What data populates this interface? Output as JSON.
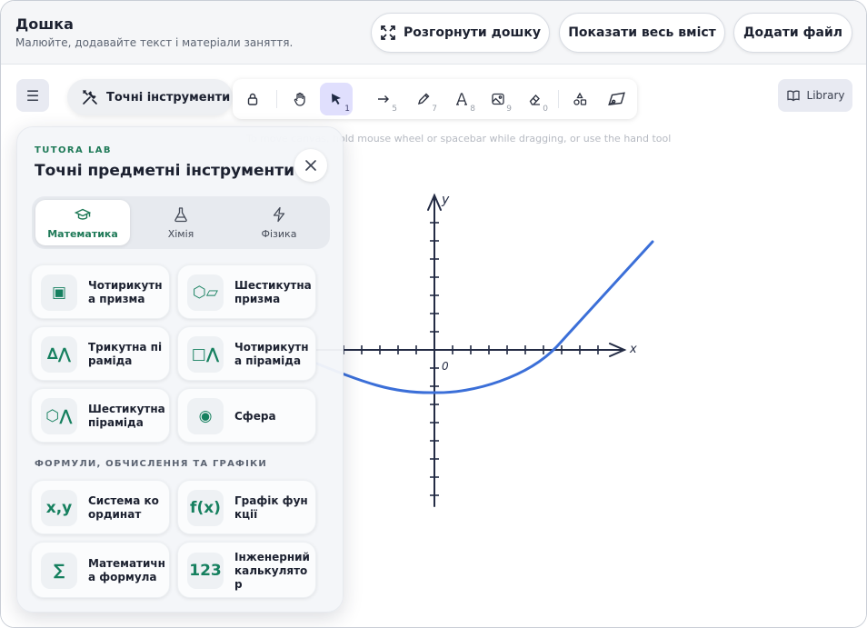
{
  "header": {
    "title": "Дошка",
    "subtitle": "Малюйте, додавайте текст і матеріали заняття.",
    "expand_label": "Розгорнути дошку",
    "show_all_label": "Показати весь вміст",
    "add_file_label": "Додати файл"
  },
  "toolbar": {
    "tools_label": "Точні інструменти",
    "keys": {
      "select": "1",
      "arrow": "5",
      "pencil": "7",
      "text": "8",
      "image": "9",
      "eraser": "0"
    },
    "active_tool": "select",
    "library_label": "Library",
    "hint": "To move canvas, hold mouse wheel or spacebar while dragging, or use the hand tool"
  },
  "graph": {
    "x_label": "x",
    "y_label": "y",
    "origin_label": "0",
    "curve_color": "#3b6fd8"
  },
  "panel": {
    "brand": "TUTORA LAB",
    "title": "Точні предметні інструменти",
    "tabs": [
      {
        "label": "Математика",
        "icon": "graduation-cap-icon",
        "active": true
      },
      {
        "label": "Хімія",
        "icon": "flask-icon",
        "active": false
      },
      {
        "label": "Фізика",
        "icon": "lightning-icon",
        "active": false
      }
    ],
    "shapes": [
      {
        "label": "Чотирикутна призма",
        "icon_text": "▣"
      },
      {
        "label": "Шестикутна призма",
        "icon_text": "⬡▱"
      },
      {
        "label": "Трикутна піраміда",
        "icon_text": "∆⋀"
      },
      {
        "label": "Чотирикутна піраміда",
        "icon_text": "□⋀"
      },
      {
        "label": "Шестикутна піраміда",
        "icon_text": "⬡⋀"
      },
      {
        "label": "Сфера",
        "icon_text": "◉"
      }
    ],
    "section_label": "ФОРМУЛИ, ОБЧИСЛЕННЯ ТА ГРАФІКИ",
    "formulas": [
      {
        "label": "Система координат",
        "icon_text": "x,y"
      },
      {
        "label": "Графік функції",
        "icon_text": "f(x)"
      },
      {
        "label": "Математична формула",
        "icon_text": "∑"
      },
      {
        "label": "Інженерний калькулятор",
        "icon_text": "123"
      }
    ]
  },
  "colors": {
    "accent_green": "#1f7a58",
    "active_tool_bg": "#e0dffd"
  }
}
